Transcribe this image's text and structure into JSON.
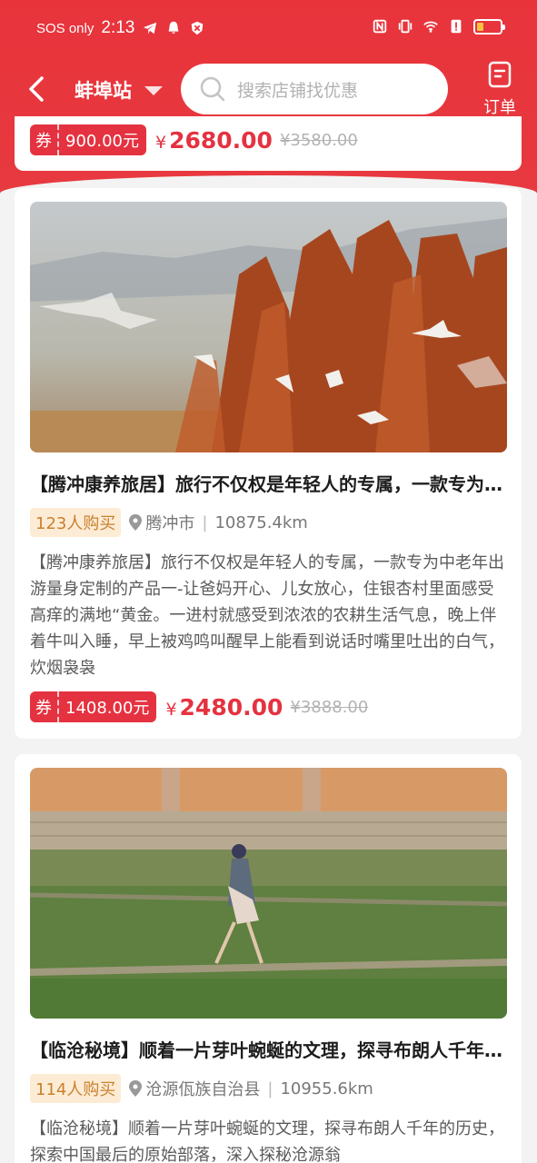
{
  "status_bar": {
    "carrier": "SOS only",
    "time": "2:13"
  },
  "header": {
    "station": "蚌埠站",
    "search_placeholder": "搜索店铺找优惠",
    "order_label": "订单"
  },
  "top_card": {
    "coupon_tag": "券",
    "coupon_amount": "900.00元",
    "currency": "¥",
    "price": "2680.00",
    "original_price": "¥3580.00"
  },
  "cards": [
    {
      "title": "【腾冲康养旅居】旅行不仅权是年轻人的专属，一款专为中老年出游量身定制的产品",
      "buyers": "123人购买",
      "location": "腾冲市",
      "distance": "10875.4km",
      "description": "【腾冲康养旅居】旅行不仅权是年轻人的专属，一款专为中老年出游量身定制的产品一-让爸妈开心、儿女放心，住银杏村里面感受高痒的满地“黄金。一进村就感受到浓浓的农耕生活气息，晚上伴着牛叫入睡，早上被鸡鸣叫醒早上能看到说话时嘴里吐出的白气，炊烟袅袅",
      "coupon_tag": "券",
      "coupon_amount": "1408.00元",
      "currency": "¥",
      "price": "2480.00",
      "original_price": "¥3888.00"
    },
    {
      "title": "【临沧秘境】顺着一片芽叶蜿蜒的文理，探寻布朗人千年的历史",
      "buyers": "114人购买",
      "location": "沧源佤族自治县",
      "distance": "10955.6km",
      "description": "【临沧秘境】顺着一片芽叶蜿蜒的文理，探寻布朗人千年的历史，探索中国最后的原始部落，深入探秘沧源翁"
    }
  ],
  "colors": {
    "brand_red": "#e53240",
    "badge_bg": "#fdecd5",
    "badge_text": "#c9812e"
  }
}
